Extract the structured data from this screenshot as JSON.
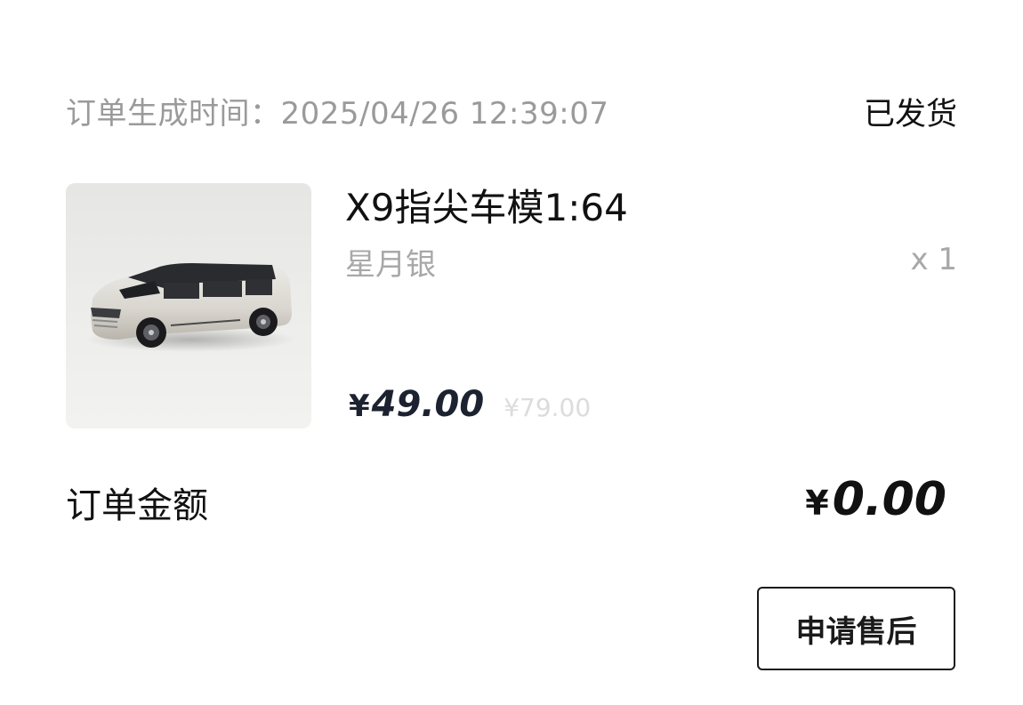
{
  "order": {
    "created_time": "订单生成时间：2025/04/26 12:39:07",
    "status": "已发货"
  },
  "product": {
    "image_icon": "car-model-image",
    "name": "X9指尖车模1:64",
    "variant": "星月银",
    "quantity": "x 1",
    "price_symbol": "¥",
    "price_current": "49.00",
    "price_original": "¥79.00"
  },
  "summary": {
    "total_label": "订单金额",
    "total_symbol": "¥",
    "total_value": "0.00"
  },
  "actions": {
    "after_sale_label": "申请售后"
  },
  "colors": {
    "primary_text": "#111111",
    "secondary_text": "#9a9a9a",
    "price_text": "#1c2230",
    "strikethrough_price": "#dcdcdc",
    "button_border": "#1a1a1a"
  }
}
